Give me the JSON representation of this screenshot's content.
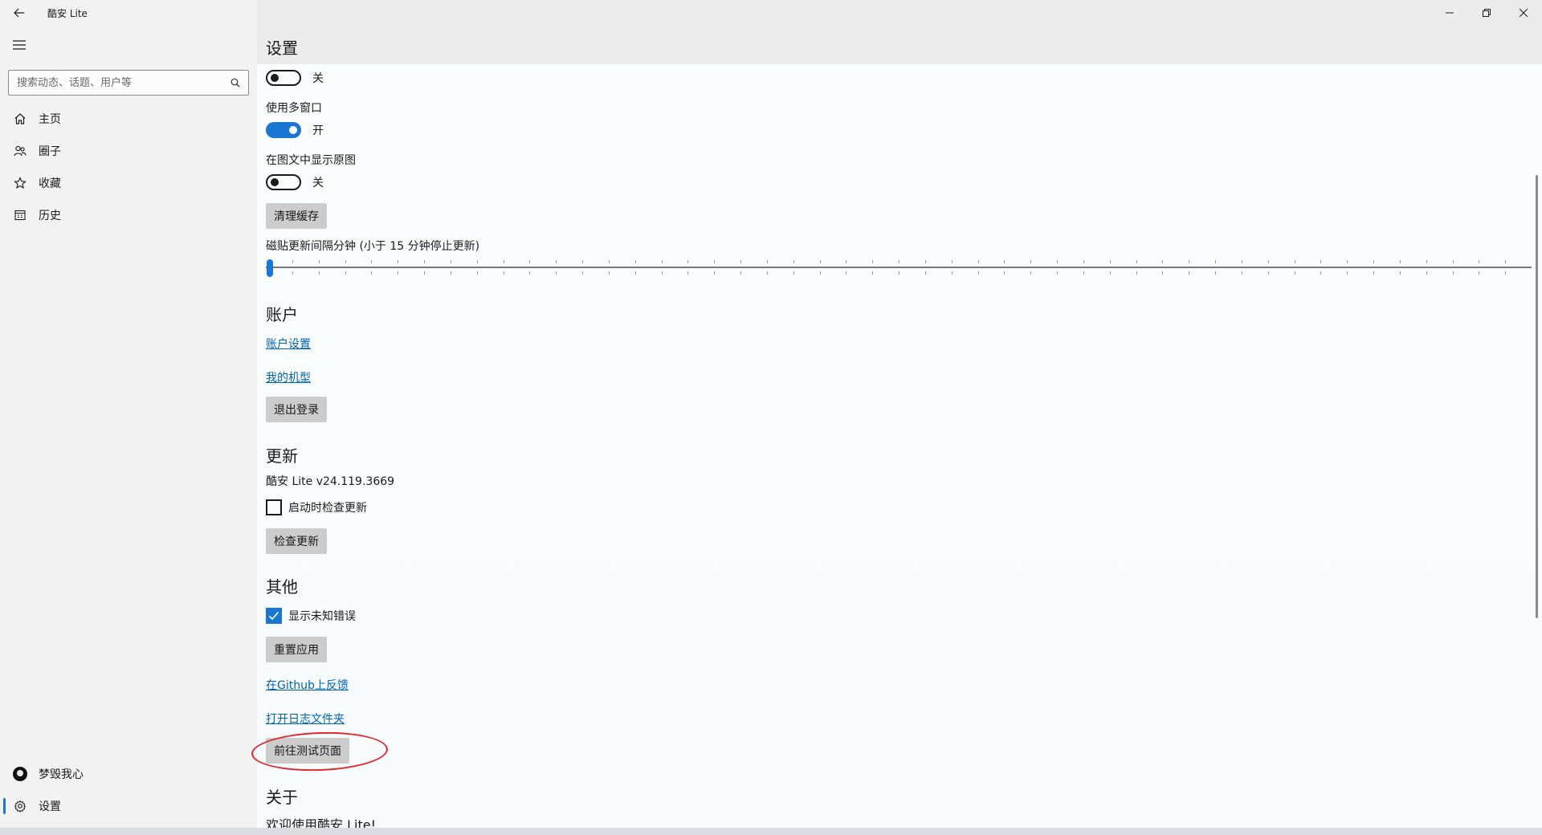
{
  "window": {
    "app_title": "酷安 Lite",
    "controls": {
      "minimize": "minimize-icon",
      "restore": "restore-icon",
      "close": "close-icon"
    }
  },
  "sidebar": {
    "search": {
      "placeholder": "搜索动态、话题、用户等",
      "value": ""
    },
    "items": [
      {
        "label": "主页",
        "icon": "home-icon"
      },
      {
        "label": "圈子",
        "icon": "people-icon"
      },
      {
        "label": "收藏",
        "icon": "star-icon"
      },
      {
        "label": "历史",
        "icon": "history-icon"
      }
    ],
    "bottom_items": [
      {
        "label": "梦毁我心",
        "icon": "avatar"
      },
      {
        "label": "设置",
        "icon": "gear-icon",
        "active": true
      }
    ]
  },
  "settings": {
    "page_title": "设置",
    "toggle_top_state": "关",
    "multi_window": {
      "label": "使用多窗口",
      "state": "开"
    },
    "show_original": {
      "label": "在图文中显示原图",
      "state": "关"
    },
    "clear_cache_label": "清理缓存",
    "tile_interval": {
      "label": "磁贴更新间隔分钟 (小于 15 分钟停止更新)",
      "value": 0
    },
    "account": {
      "title": "账户",
      "settings_link": "账户设置",
      "my_device_link": "我的机型",
      "logout_label": "退出登录"
    },
    "update": {
      "title": "更新",
      "version": "酷安 Lite v24.119.3669",
      "check_on_start": "启动时检查更新",
      "check_on_start_checked": false,
      "check_label": "检查更新"
    },
    "other": {
      "title": "其他",
      "show_unknown_errors": "显示未知错误",
      "show_unknown_errors_checked": true,
      "reset_label": "重置应用",
      "github_feedback": "在Github上反馈",
      "open_log_folder": "打开日志文件夹",
      "test_page_label": "前往测试页面"
    },
    "about": {
      "title": "关于",
      "welcome": "欢迎使用酷安 Lite!"
    }
  }
}
